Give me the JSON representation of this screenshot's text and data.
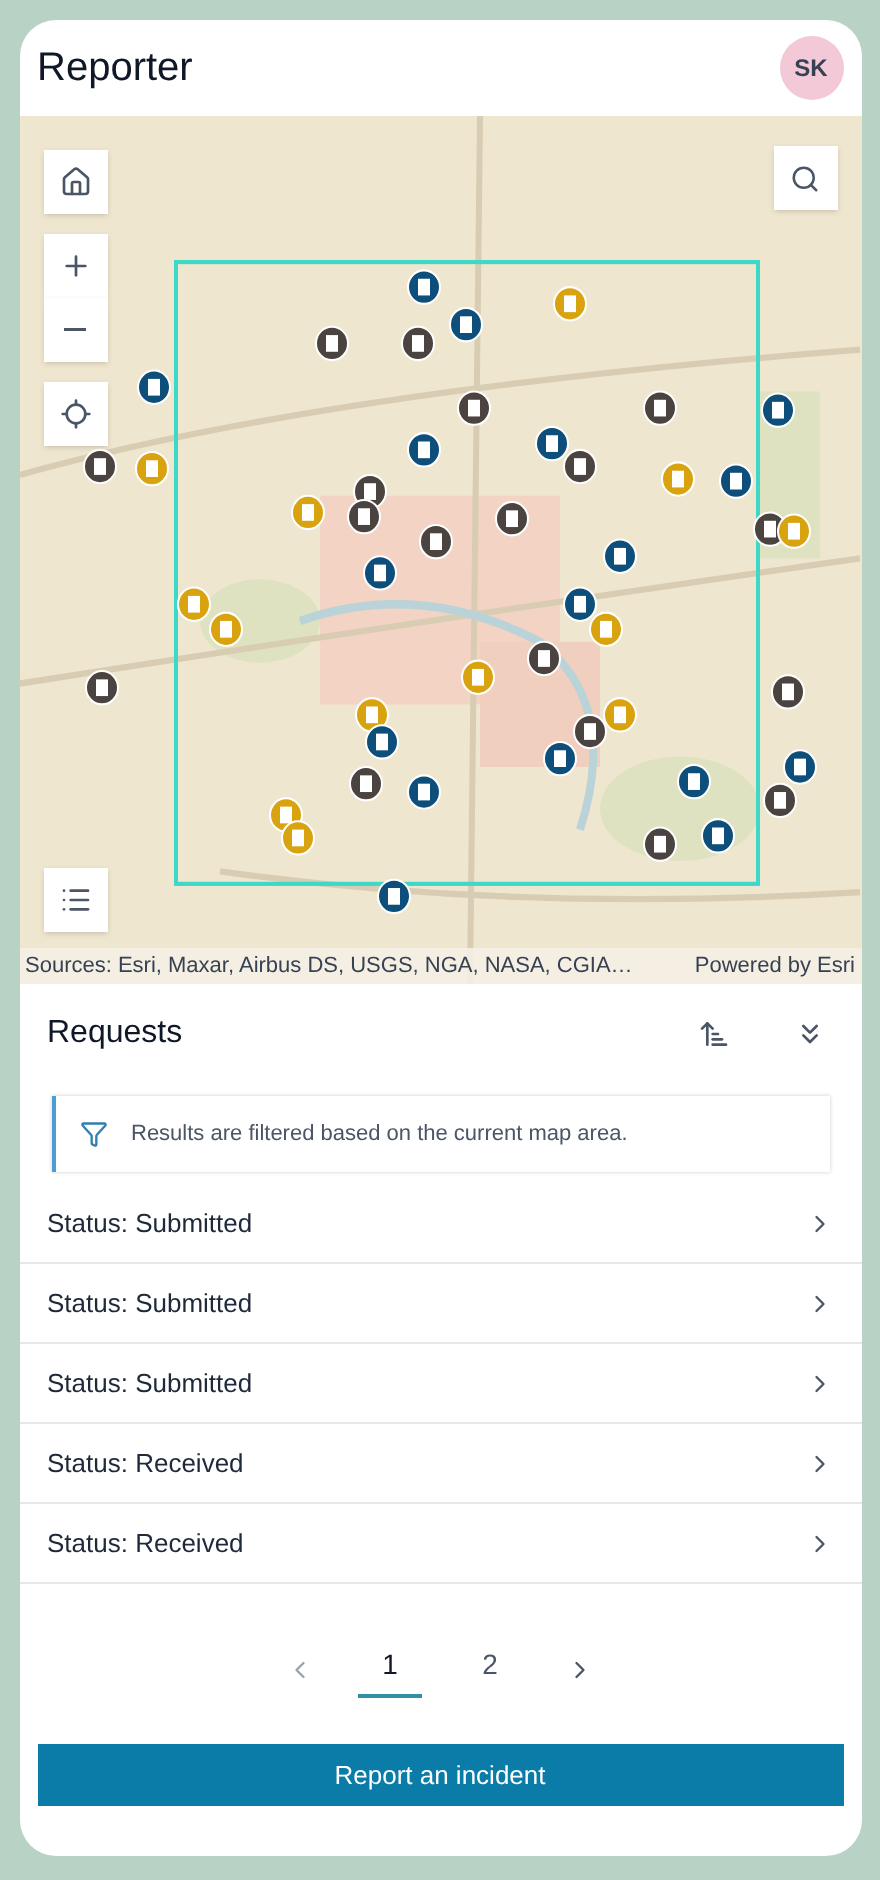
{
  "header": {
    "title": "Reporter",
    "avatar": "SK"
  },
  "map": {
    "attribution": "Sources: Esri, Maxar, Airbus DS, USGS, NGA, NASA, CGIA…",
    "powered_by": "Powered by Esri"
  },
  "requests": {
    "title": "Requests",
    "notice": "Results are filtered based on the current map area.",
    "rows": [
      {
        "label": "Status: Submitted"
      },
      {
        "label": "Status: Submitted"
      },
      {
        "label": "Status: Submitted"
      },
      {
        "label": "Status: Received"
      },
      {
        "label": "Status: Received"
      }
    ],
    "pages": [
      {
        "label": "1",
        "selected": true
      },
      {
        "label": "2",
        "selected": false
      }
    ]
  },
  "action_button": "Report an incident"
}
